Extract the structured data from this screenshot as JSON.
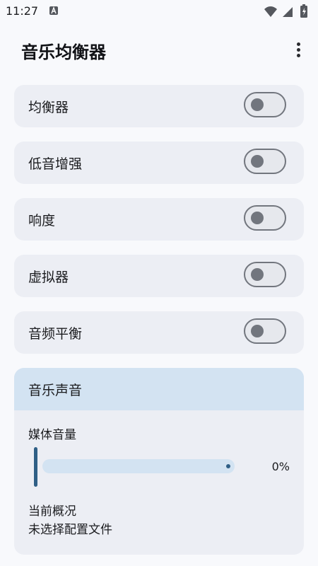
{
  "status_bar": {
    "time": "11:27",
    "icons": [
      "a-notification-icon",
      "wifi-icon",
      "signal-icon",
      "battery-charging-icon"
    ]
  },
  "app_bar": {
    "title": "音乐均衡器",
    "menu_icon": "more-vert-icon"
  },
  "toggles": [
    {
      "label": "均衡器",
      "on": false
    },
    {
      "label": "低音增强",
      "on": false
    },
    {
      "label": "响度",
      "on": false
    },
    {
      "label": "虚拟器",
      "on": false
    },
    {
      "label": "音频平衡",
      "on": false
    }
  ],
  "music_card": {
    "header": "音乐声音",
    "media_volume_label": "媒体音量",
    "volume_percent": "0%",
    "volume_value": 0,
    "overview_title": "当前概况",
    "overview_value": "未选择配置文件"
  },
  "colors": {
    "background": "#f8f9fc",
    "card": "#eceef4",
    "accent_light": "#d3e3f2",
    "accent_dark": "#2f5f86",
    "switch_outline": "#72767e"
  }
}
